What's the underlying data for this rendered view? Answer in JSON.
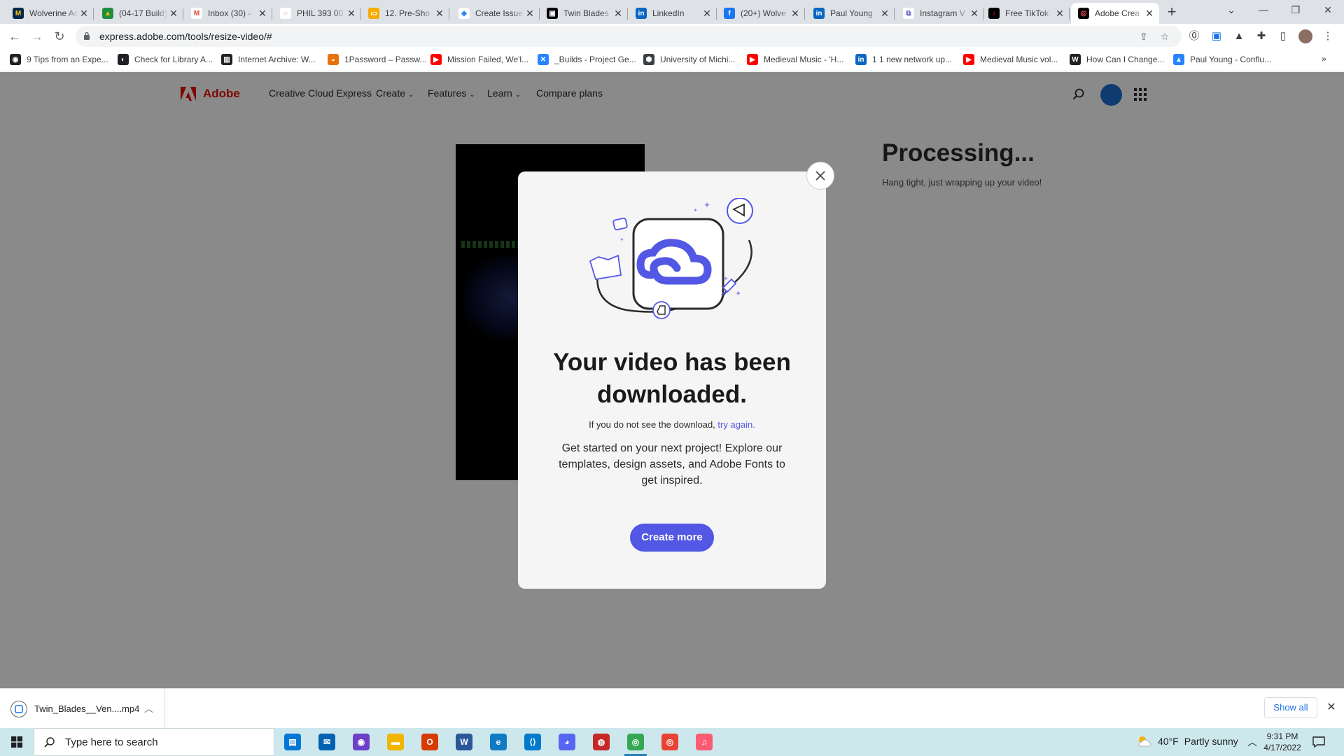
{
  "browser": {
    "tabs": [
      {
        "title": "Wolverine Access",
        "fav_color": "#00274c",
        "fav_text": "M",
        "fav_fg": "#ffcb05",
        "icon": "wolverine-m-icon"
      },
      {
        "title": "(04-17 Build)",
        "fav_color": "#1e8e3e",
        "fav_text": "▲",
        "fav_fg": "#fbbc04",
        "icon": "google-drive-icon"
      },
      {
        "title": "Inbox (30) - ",
        "fav_color": "#ffffff",
        "fav_text": "M",
        "fav_fg": "#ea4335",
        "icon": "gmail-icon"
      },
      {
        "title": "PHIL 393 00",
        "fav_color": "#ffffff",
        "fav_text": "◌",
        "fav_fg": "#d93025",
        "icon": "canvas-icon"
      },
      {
        "title": "12. Pre-Sho",
        "fav_color": "#f9ab00",
        "fav_text": "▭",
        "fav_fg": "#ffffff",
        "icon": "google-slides-icon"
      },
      {
        "title": "Create Issue",
        "fav_color": "#ffffff",
        "fav_text": "◆",
        "fav_fg": "#2684ff",
        "icon": "jira-icon"
      },
      {
        "title": "Twin Blades",
        "fav_color": "#000000",
        "fav_text": "▣",
        "fav_fg": "#ffffff",
        "icon": "game-icon"
      },
      {
        "title": "LinkedIn",
        "fav_color": "#0a66c2",
        "fav_text": "in",
        "fav_fg": "#ffffff",
        "icon": "linkedin-icon"
      },
      {
        "title": "(20+) Wolve",
        "fav_color": "#1877f2",
        "fav_text": "f",
        "fav_fg": "#ffffff",
        "icon": "facebook-icon"
      },
      {
        "title": "Paul Young",
        "fav_color": "#0a66c2",
        "fav_text": "in",
        "fav_fg": "#ffffff",
        "icon": "linkedin-icon"
      },
      {
        "title": "Instagram V",
        "fav_color": "#ffffff",
        "fav_text": "⧉",
        "fav_fg": "#5b5fc7",
        "icon": "instagram-icon"
      },
      {
        "title": "Free TikTok",
        "fav_color": "#000000",
        "fav_text": "♪",
        "fav_fg": "#ff0050",
        "icon": "tiktok-icon"
      },
      {
        "title": "Adobe Crea",
        "fav_color": "#000000",
        "fav_text": "◎",
        "fav_fg": "#ff4f5a",
        "icon": "adobe-express-icon",
        "active": true
      }
    ],
    "new_tab": "+",
    "url": "express.adobe.com/tools/resize-video/#",
    "bookmarks": [
      {
        "label": "9 Tips from an Expe...",
        "color": "#202124",
        "glyph": "◉",
        "icon": "globe-icon"
      },
      {
        "label": "Check for Library A...",
        "color": "#202124",
        "glyph": "◐",
        "icon": "library-icon"
      },
      {
        "label": "Internet Archive: W...",
        "color": "#202124",
        "glyph": "▥",
        "icon": "archive-icon"
      },
      {
        "label": "1Password – Passw...",
        "color": "#e8710a",
        "glyph": "◒",
        "icon": "onepassword-icon"
      },
      {
        "label": "Mission Failed, We'l...",
        "color": "#ff0000",
        "glyph": "▶",
        "icon": "youtube-icon"
      },
      {
        "label": "_Builds - Project Ge...",
        "color": "#2684ff",
        "glyph": "✕",
        "icon": "confluence-icon"
      },
      {
        "label": "University of Michi...",
        "color": "#3c4043",
        "glyph": "⬢",
        "icon": "cube-icon"
      },
      {
        "label": "Medieval Music - 'H...",
        "color": "#ff0000",
        "glyph": "▶",
        "icon": "youtube-icon"
      },
      {
        "label": "1 1 new network up...",
        "color": "#0a66c2",
        "glyph": "in",
        "icon": "linkedin-icon"
      },
      {
        "label": "Medieval Music vol...",
        "color": "#ff0000",
        "glyph": "▶",
        "icon": "youtube-icon"
      },
      {
        "label": "How Can I Change...",
        "color": "#202124",
        "glyph": "W",
        "icon": "wikihow-icon"
      },
      {
        "label": "Paul Young - Conflu...",
        "color": "#2684ff",
        "glyph": "▲",
        "icon": "confluence-icon"
      }
    ],
    "bookmarks_overflow": "»"
  },
  "adobe_header": {
    "brand": "Adobe",
    "links": [
      {
        "label": "Creative Cloud Express",
        "dropdown": false
      },
      {
        "label": "Create",
        "dropdown": true
      },
      {
        "label": "Features",
        "dropdown": true
      },
      {
        "label": "Learn",
        "dropdown": true
      },
      {
        "label": "Compare plans",
        "dropdown": false
      }
    ]
  },
  "processing": {
    "title": "Processing...",
    "subtitle": "Hang tight, just wrapping up your video!"
  },
  "modal": {
    "title": "Your video has been downloaded.",
    "retry_prefix": "If you do not see the download, ",
    "retry_link": "try again.",
    "promo": "Get started on your next project! Explore our templates, design assets, and Adobe Fonts to get inspired.",
    "cta": "Create more",
    "accent": "#5258e4"
  },
  "download_shelf": {
    "file_name": "Twin_Blades__Ven....mp4",
    "show_all": "Show all"
  },
  "taskbar": {
    "search_placeholder": "Type here to search",
    "apps": [
      {
        "name": "store-app",
        "color": "#0078d4",
        "glyph": "▤"
      },
      {
        "name": "mail-app",
        "color": "#0063b1",
        "glyph": "✉"
      },
      {
        "name": "github-app",
        "color": "#6e40c9",
        "glyph": "◉"
      },
      {
        "name": "file-explorer-app",
        "color": "#f2b600",
        "glyph": "▬"
      },
      {
        "name": "office-app",
        "color": "#d83b01",
        "glyph": "O"
      },
      {
        "name": "word-app",
        "color": "#2b579a",
        "glyph": "W"
      },
      {
        "name": "edge-app",
        "color": "#0f7bc4",
        "glyph": "e"
      },
      {
        "name": "vscode-app",
        "color": "#007acc",
        "glyph": "⟨⟩"
      },
      {
        "name": "discord-app",
        "color": "#5865f2",
        "glyph": "◕"
      },
      {
        "name": "davinci-app",
        "color": "#c62828",
        "glyph": "◍"
      },
      {
        "name": "chrome-app",
        "color": "#34a853",
        "glyph": "◎",
        "active": true
      },
      {
        "name": "chrome-profile-app",
        "color": "#ea4335",
        "glyph": "◎"
      },
      {
        "name": "itunes-app",
        "color": "#fb5c74",
        "glyph": "♫"
      }
    ],
    "weather": {
      "temp": "40°F",
      "condition": "Partly sunny"
    },
    "time": "9:31 PM",
    "date": "4/17/2022"
  }
}
